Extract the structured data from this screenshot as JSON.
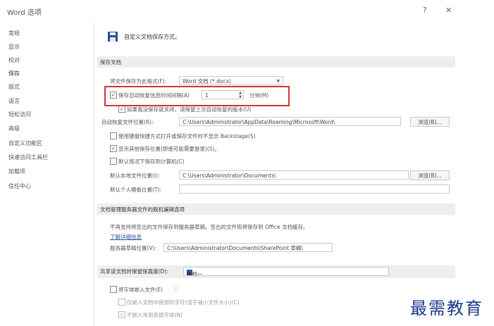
{
  "window": {
    "title": "Word 选项",
    "help": "?",
    "close": "✕"
  },
  "nav": {
    "items": [
      {
        "label": "常规",
        "active": false
      },
      {
        "label": "显示",
        "active": false
      },
      {
        "label": "校对",
        "active": false
      },
      {
        "label": "保存",
        "active": true
      },
      {
        "label": "版式",
        "active": false
      },
      {
        "label": "语言",
        "active": false
      },
      {
        "label": "轻松访问",
        "active": false
      },
      {
        "label": "高级",
        "active": false
      },
      {
        "label": "自定义功能区",
        "active": false
      },
      {
        "label": "快速访问工具栏",
        "active": false
      },
      {
        "label": "加载项",
        "active": false
      },
      {
        "label": "信任中心",
        "active": false
      }
    ]
  },
  "header": {
    "heading": "自定义文档保存方式。",
    "icon": "save-icon"
  },
  "save_docs": {
    "section_title": "保存文档",
    "format_label": "将文件保存为此格式(F):",
    "format_value": "Word 文档 (*.docx)",
    "autorecover_label": "保存自动恢复信息时间间隔(A)",
    "autorecover_checked": true,
    "autorecover_minutes": "1",
    "minutes_label": "分钟(M)",
    "keep_last_label": "如果我没保存就关闭，请保留上次自动恢复的版本(U)",
    "keep_last_checked": true,
    "autorecover_path_label": "自动恢复文件位置(R):",
    "autorecover_path": "C:\\Users\\Administrator\\AppData\\Roaming\\Microsoft\\Word\\",
    "browse_label": "浏览(B)...",
    "keyboard_backstage_label": "使用键盘快捷方式打开或保存文件时不显示 Backstage(S)",
    "keyboard_backstage_checked": false,
    "show_other_locations_label": "显示其他保存位置(即使可能需要登录)(S)。",
    "show_other_locations_checked": true,
    "save_to_computer_label": "默认情况下保存到计算机(C)",
    "save_to_computer_checked": false,
    "default_local_label": "默认本地文件位置(I):",
    "default_local_path": "C:\\Users\\Administrator\\Documents\\",
    "browse2_label": "浏览(B)...",
    "personal_templates_label": "默认个人模板位置(T):",
    "personal_templates_path": ""
  },
  "offline": {
    "section_title": "文档管理服务器文件的脱机编辑选项",
    "description": "不再支持将签出的文件保存到服务器草稿。签出的文件现将保存到 Office 文档缓存。",
    "learn_more": "了解详细信息",
    "drafts_label": "服务器草稿位置(V):",
    "drafts_path": "C:\\Users\\Administrator\\Documents\\SharePoint 草稿\\"
  },
  "fidelity": {
    "section_title": "共享该文档时保留保真度(D):",
    "doc_value": "文档一",
    "embed_fonts_label": "将字体嵌入文件(E)",
    "embed_fonts_checked": false,
    "embed_used_chars_label": "仅嵌入文档中使用的字符(适于减小文件大小)(C)",
    "embed_used_chars_checked": false,
    "no_common_fonts_label": "不嵌入常用系统字体(N)",
    "no_common_fonts_checked": true
  },
  "watermark": "最需教育"
}
